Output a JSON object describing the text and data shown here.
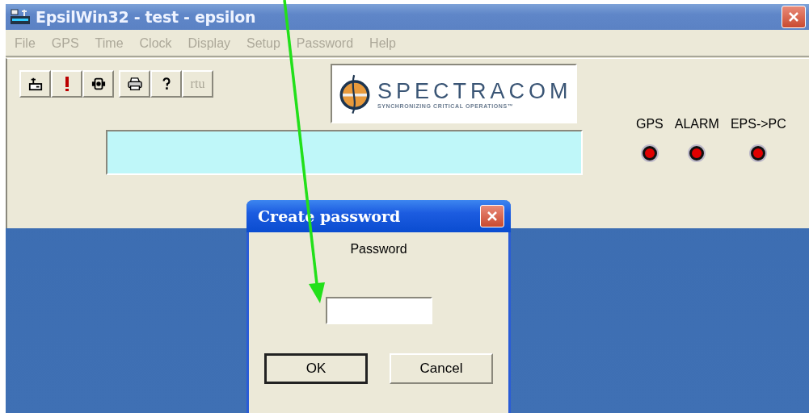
{
  "window": {
    "title": "EpsilWin32 - test - epsilon"
  },
  "menu": [
    {
      "label": "File",
      "disabled": true
    },
    {
      "label": "GPS",
      "disabled": true
    },
    {
      "label": "Time",
      "disabled": true
    },
    {
      "label": "Clock",
      "disabled": true
    },
    {
      "label": "Display",
      "disabled": true
    },
    {
      "label": "Setup",
      "disabled": true
    },
    {
      "label": "Password",
      "disabled": true
    },
    {
      "label": "Help",
      "disabled": true
    }
  ],
  "toolbar": [
    [
      {
        "kind": "device"
      },
      {
        "kind": "alert"
      },
      {
        "kind": "camera"
      }
    ],
    [
      {
        "kind": "printer"
      },
      {
        "kind": "help"
      },
      {
        "kind": "text",
        "label": "rtu",
        "disabled": true
      }
    ]
  ],
  "logo": {
    "name": "SPECTRACOM",
    "tagline": "SYNCHRONIZING CRITICAL OPERATIONS™"
  },
  "indicators": [
    {
      "label": "GPS",
      "color": "#e00000"
    },
    {
      "label": "ALARM",
      "color": "#e00000"
    },
    {
      "label": "EPS->PC",
      "color": "#e00000"
    }
  ],
  "dialog": {
    "title": "Create password",
    "label": "Password",
    "buttons": [
      {
        "label": "OK",
        "default": true
      },
      {
        "label": "Cancel",
        "default": false
      }
    ]
  }
}
